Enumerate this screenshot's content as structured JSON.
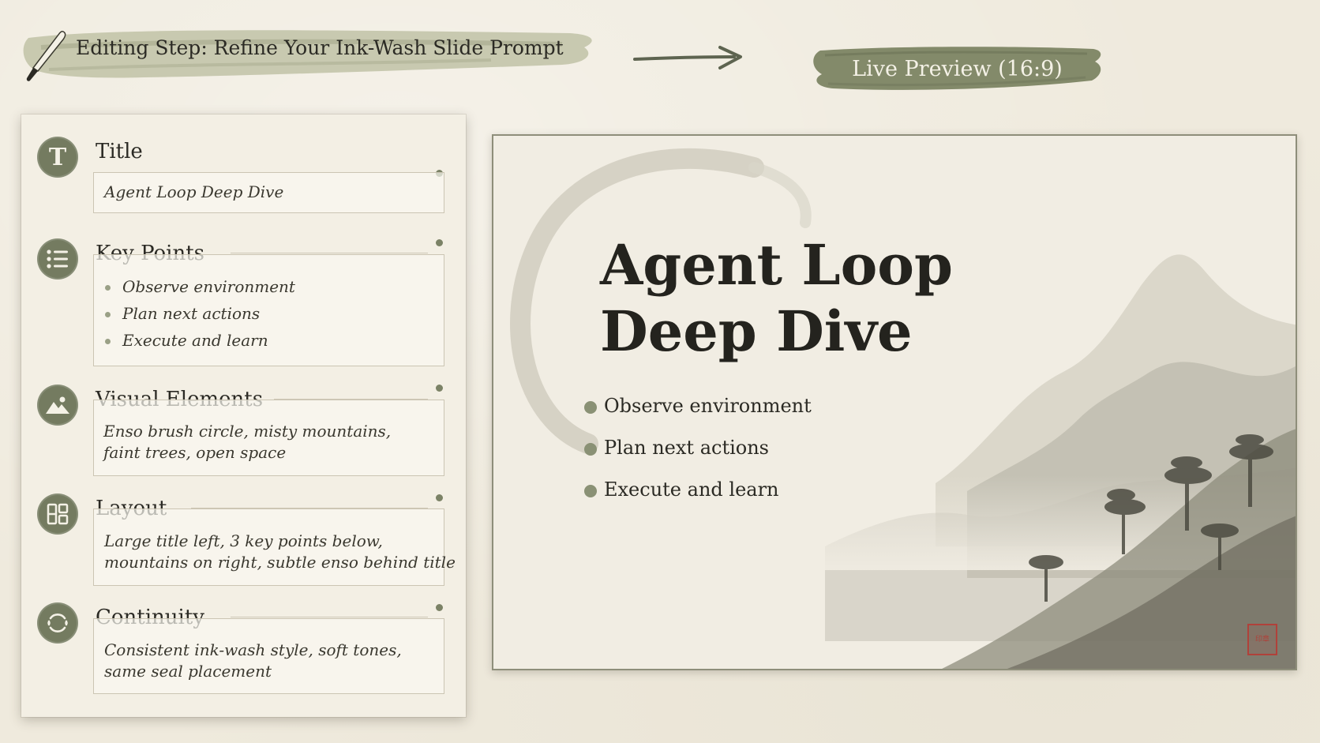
{
  "header": {
    "title": "Editing Step: Refine Your Ink-Wash Slide Prompt",
    "preview_label": "Live Preview (16:9)"
  },
  "sections": {
    "title": {
      "label": "Title",
      "value": "Agent Loop Deep Dive",
      "icon": "letter-t-icon"
    },
    "key_points": {
      "label": "Key Points",
      "icon": "list-icon",
      "items": [
        "Observe environment",
        "Plan next actions",
        "Execute and learn"
      ]
    },
    "visual_elements": {
      "label": "Visual Elements",
      "icon": "mountain-image-icon",
      "lines": [
        "Enso brush circle, misty mountains,",
        "faint trees, open space"
      ]
    },
    "layout": {
      "label": "Layout",
      "icon": "layout-grid-icon",
      "lines": [
        "Large title left, 3 key points below,",
        "mountains on right, subtle enso behind title"
      ]
    },
    "continuity": {
      "label": "Continuity",
      "icon": "cycle-arrows-icon",
      "lines": [
        "Consistent ink-wash style, soft tones,",
        "same seal placement"
      ]
    }
  },
  "slide": {
    "title_line1": "Agent Loop",
    "title_line2": "Deep Dive",
    "points": [
      "Observe environment",
      "Plan next actions",
      "Execute and learn"
    ],
    "seal_text": "印章"
  },
  "colors": {
    "background": "#efeadd",
    "accent_green": "#747b60",
    "brush_green": "#8b916f",
    "ink": "#2b2a24",
    "seal_red": "#b0413a"
  }
}
